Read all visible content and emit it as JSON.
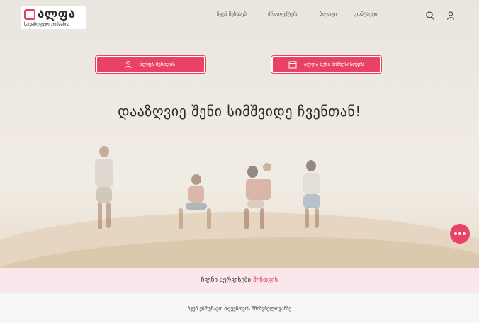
{
  "header": {
    "logo": {
      "mark_color": "#e63e6d",
      "name": "ალფა",
      "subtitle": "სადაზღვევო კომპანია"
    },
    "nav": [
      {
        "label": "ჩვენ შესახებ"
      },
      {
        "label": "პროდუქტები"
      },
      {
        "label": "ბლოგი"
      },
      {
        "label": "კონტაქტი"
      }
    ],
    "icons": {
      "search": "search-icon",
      "account": "user-icon"
    }
  },
  "hero": {
    "cta_personal": {
      "label": "ალფა შენთვის",
      "icon": "user-icon"
    },
    "cta_business": {
      "label": "ალფა შენი ბიზნესისთვის",
      "icon": "calendar-icon"
    },
    "headline": "დააზღვიე შენი სიმშვიდე ჩვენთან!",
    "accent_color": "#ea4167"
  },
  "services": {
    "title_main": "ჩვენი სერვისები",
    "title_accent": "შენთვის",
    "subtitle": "ჩვენ ვზრუნავთ თქვენთვის მნიშვნელოვანზე"
  },
  "chat": {
    "icon": "chat-icon"
  }
}
